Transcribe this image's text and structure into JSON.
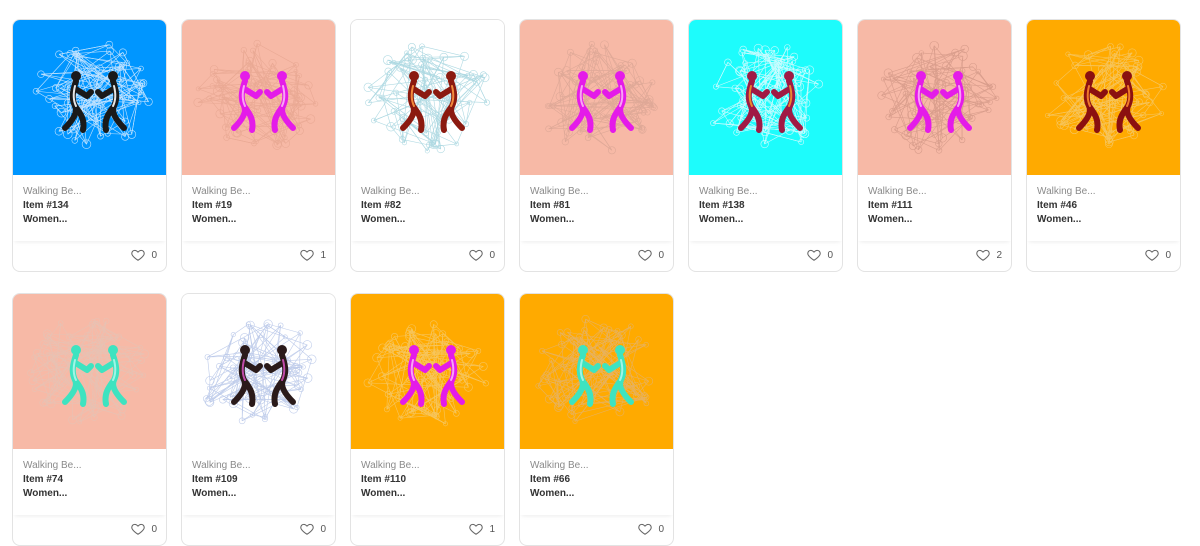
{
  "icons": {
    "like": "heart-outline-icon"
  },
  "cards": [
    {
      "bg": "#0096ff",
      "figure": "#1a1a1a",
      "accent": "#e6e6e6",
      "net": "#d9ecff",
      "collection": "Walking Be...",
      "name": "Item #134",
      "sub": "Women...",
      "likes": "0"
    },
    {
      "bg": "#f7b9a6",
      "figure": "#e41be9",
      "accent": "#f9a3f5",
      "net": "#e8a893",
      "collection": "Walking Be...",
      "name": "Item #19",
      "sub": "Women...",
      "likes": "1"
    },
    {
      "bg": "#ffffff",
      "figure": "#8b1a10",
      "accent": "#f28a3c",
      "net": "#a6d5df",
      "collection": "Walking Be...",
      "name": "Item #82",
      "sub": "Women...",
      "likes": "0"
    },
    {
      "bg": "#f7b9a6",
      "figure": "#e41be9",
      "accent": "#f9a3f5",
      "net": "#dca796",
      "collection": "Walking Be...",
      "name": "Item #81",
      "sub": "Women...",
      "likes": "0"
    },
    {
      "bg": "#1dfcfc",
      "figure": "#a01a45",
      "accent": "#e8892e",
      "net": "#dffcff",
      "collection": "Walking Be...",
      "name": "Item #138",
      "sub": "Women...",
      "likes": "0"
    },
    {
      "bg": "#f7b9a6",
      "figure": "#e41be9",
      "accent": "#f9a3f5",
      "net": "#d59a89",
      "collection": "Walking Be...",
      "name": "Item #111",
      "sub": "Women...",
      "likes": "2"
    },
    {
      "bg": "#ffaa00",
      "figure": "#8b1010",
      "accent": "#f07a2a",
      "net": "#f5c96a",
      "collection": "Walking Be...",
      "name": "Item #46",
      "sub": "Women...",
      "likes": "0"
    },
    {
      "bg": "#f7b9a6",
      "figure": "#3ee3c0",
      "accent": "#a0f5e6",
      "net": "#e6c3b5",
      "collection": "Walking Be...",
      "name": "Item #74",
      "sub": "Women...",
      "likes": "0"
    },
    {
      "bg": "#ffffff",
      "figure": "#2a1a1a",
      "accent": "#c04ba9",
      "net": "#b7c6e8",
      "collection": "Walking Be...",
      "name": "Item #109",
      "sub": "Women...",
      "likes": "0"
    },
    {
      "bg": "#ffaa00",
      "figure": "#e41be9",
      "accent": "#f9a3f5",
      "net": "#f5c96a",
      "collection": "Walking Be...",
      "name": "Item #110",
      "sub": "Women...",
      "likes": "1"
    },
    {
      "bg": "#ffaa00",
      "figure": "#3ee3c0",
      "accent": "#a0f5e6",
      "net": "#e5b36a",
      "collection": "Walking Be...",
      "name": "Item #66",
      "sub": "Women...",
      "likes": "0"
    }
  ]
}
